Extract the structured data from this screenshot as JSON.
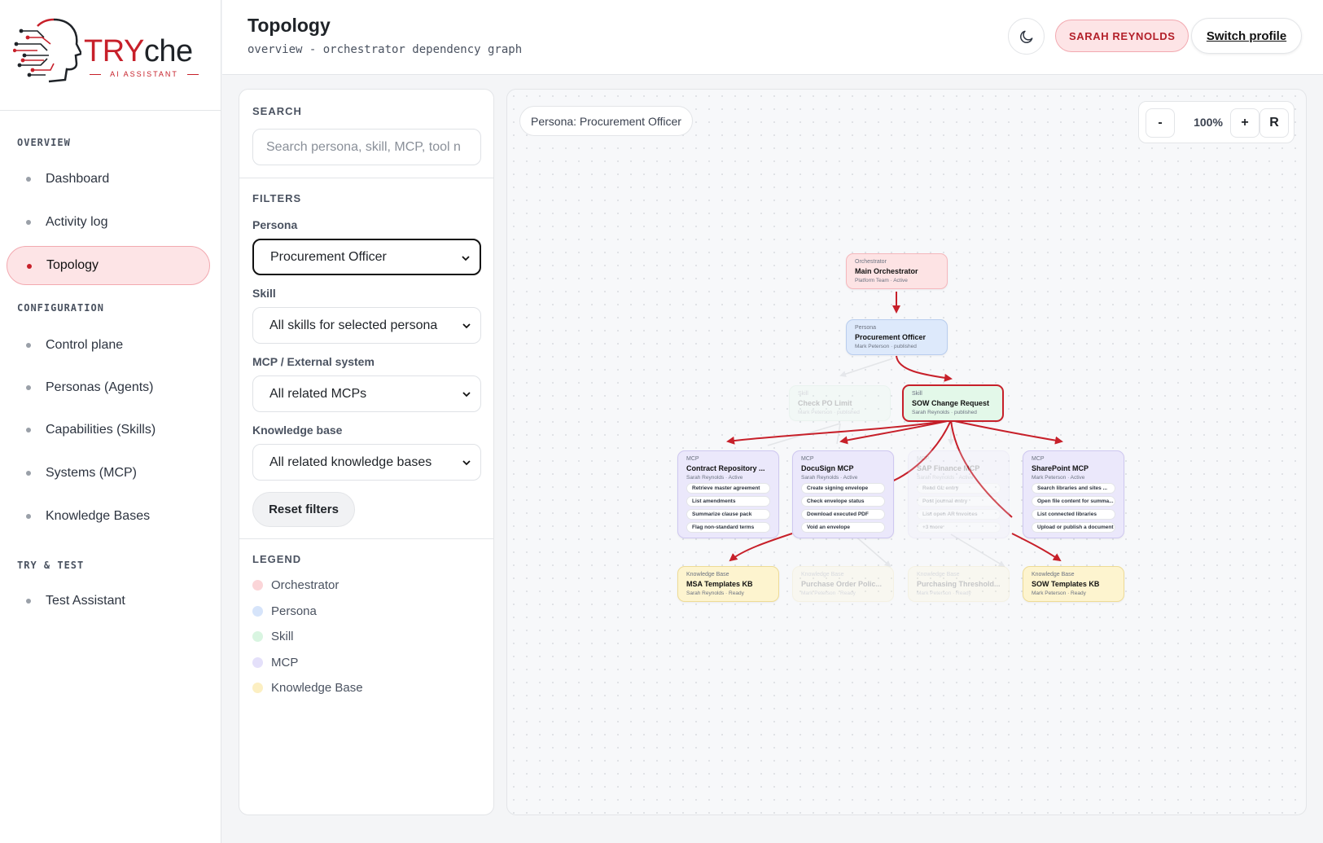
{
  "brand": {
    "word_try": "TRY",
    "word_che": "che",
    "tagline": "AI ASSISTANT",
    "accent": "#c7202a"
  },
  "sidebar": {
    "sections": [
      {
        "label": "OVERVIEW"
      },
      {
        "label": "CONFIGURATION"
      },
      {
        "label": "TRY & TEST"
      }
    ],
    "items": [
      {
        "label": "Dashboard"
      },
      {
        "label": "Activity log"
      },
      {
        "label": "Topology",
        "active": true
      },
      {
        "label": "Control plane"
      },
      {
        "label": "Personas (Agents)"
      },
      {
        "label": "Capabilities (Skills)"
      },
      {
        "label": "Systems (MCP)"
      },
      {
        "label": "Knowledge Bases"
      },
      {
        "label": "Test Assistant"
      }
    ]
  },
  "header": {
    "title": "Topology",
    "subtitle": "overview - orchestrator dependency graph",
    "theme_icon": "moon-icon",
    "user": "SARAH REYNOLDS",
    "switch_label": "Switch profile"
  },
  "filters": {
    "search_label": "SEARCH",
    "search_placeholder": "Search persona, skill, MCP, tool n",
    "filters_label": "FILTERS",
    "persona_label": "Persona",
    "persona_value": "Procurement Officer",
    "skill_label": "Skill",
    "skill_value": "All skills for selected persona",
    "mcp_label": "MCP / External system",
    "mcp_value": "All related MCPs",
    "kb_label": "Knowledge base",
    "kb_value": "All related knowledge bases",
    "reset_label": "Reset filters"
  },
  "legend": {
    "title": "LEGEND",
    "items": [
      {
        "label": "Orchestrator",
        "color": "#fbd5d8"
      },
      {
        "label": "Persona",
        "color": "#d6e4fa"
      },
      {
        "label": "Skill",
        "color": "#d9f5e1"
      },
      {
        "label": "MCP",
        "color": "#e4e0fa"
      },
      {
        "label": "Knowledge Base",
        "color": "#fcefc2"
      }
    ]
  },
  "graph": {
    "persona_chip": "Persona: Procurement Officer",
    "zoom": {
      "minus": "-",
      "value": "100%",
      "plus": "+",
      "reset": "R"
    },
    "orchestrator": {
      "type": "Orchestrator",
      "name": "Main Orchestrator",
      "meta": "Platform Team · Active"
    },
    "persona": {
      "type": "Persona",
      "name": "Procurement Officer",
      "meta": "Mark Peterson · published"
    },
    "skills": [
      {
        "type": "Skill",
        "name": "Check PO Limit",
        "meta": "Mark Peterson · published",
        "faded": true
      },
      {
        "type": "Skill",
        "name": "SOW Change Request",
        "meta": "Sarah Reynolds · published",
        "selected": true
      }
    ],
    "mcps": [
      {
        "type": "MCP",
        "name": "Contract Repository ...",
        "meta": "Sarah Reynolds · Active",
        "tools": [
          "Retrieve master agreement",
          "List amendments",
          "Summarize clause pack",
          "Flag non-standard terms"
        ]
      },
      {
        "type": "MCP",
        "name": "DocuSign MCP",
        "meta": "Sarah Reynolds · Active",
        "tools": [
          "Create signing envelope",
          "Check envelope status",
          "Download executed PDF",
          "Void an envelope"
        ]
      },
      {
        "type": "MCP",
        "name": "SAP Finance MCP",
        "meta": "Sarah Reynolds · Active",
        "tools": [
          "Read GL entry",
          "Post journal entry",
          "List open AR invoices",
          "+3 more"
        ],
        "faded": true
      },
      {
        "type": "MCP",
        "name": "SharePoint MCP",
        "meta": "Mark Peterson · Active",
        "tools": [
          "Search libraries and sites ...",
          "Open file content for summa...",
          "List connected libraries",
          "Upload or publish a document"
        ]
      }
    ],
    "kbs": [
      {
        "type": "Knowledge Base",
        "name": "MSA Templates KB",
        "meta": "Sarah Reynolds · Ready"
      },
      {
        "type": "Knowledge Base",
        "name": "Purchase Order Polic...",
        "meta": "Mark Peterson · Ready",
        "faded": true
      },
      {
        "type": "Knowledge Base",
        "name": "Purchasing Threshold...",
        "meta": "Mark Peterson · Ready",
        "faded": true
      },
      {
        "type": "Knowledge Base",
        "name": "SOW Templates KB",
        "meta": "Mark Peterson · Ready"
      }
    ],
    "edge_color": "#c7202a"
  }
}
